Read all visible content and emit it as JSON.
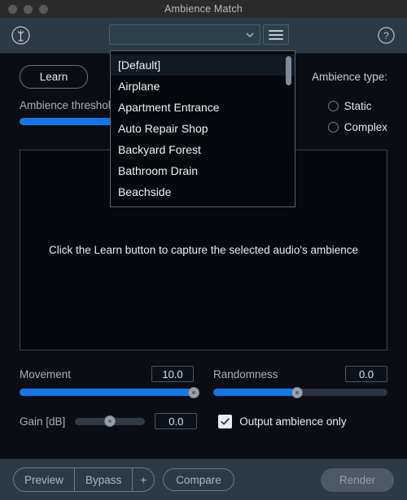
{
  "window": {
    "title": "Ambience Match",
    "traffic_lights": [
      "close",
      "minimize",
      "zoom"
    ]
  },
  "header": {
    "logo_icon": "tree-circle-icon",
    "preset_combobox": {
      "value": "",
      "placeholder": "",
      "chevron_icon": "chevron-down-icon"
    },
    "menu_button_icon": "hamburger-menu-icon",
    "help_icon": "help-circle-icon"
  },
  "dropdown": {
    "open": true,
    "items": [
      "[Default]",
      "Airplane",
      "Apartment Entrance",
      "Auto Repair Shop",
      "Backyard Forest",
      "Bathroom Drain",
      "Beachside"
    ],
    "selected_index": 0,
    "scrollbar_position": "top"
  },
  "controls": {
    "learn_button": "Learn",
    "type_label": "Ambience type:",
    "type_options": [
      {
        "label": "Static",
        "selected": false
      },
      {
        "label": "Complex",
        "selected": false
      }
    ],
    "threshold": {
      "label": "Ambience threshold",
      "fill_percent": 100
    }
  },
  "display": {
    "message": "Click the Learn button to capture the selected audio's ambience"
  },
  "params": [
    {
      "name": "Movement",
      "value": "10.0",
      "fill_percent": 100,
      "knob_percent": 100
    },
    {
      "name": "Randomness",
      "value": "0.0",
      "fill_percent": 48,
      "knob_percent": 48
    }
  ],
  "gain": {
    "label": "Gain [dB]",
    "value": "0.0",
    "knob_percent": 50
  },
  "output_ambience": {
    "label": "Output ambience only",
    "checked": true,
    "check_icon": "checkmark-icon"
  },
  "footer": {
    "preview": "Preview",
    "bypass": "Bypass",
    "add": "+",
    "compare": "Compare",
    "render": "Render"
  },
  "colors": {
    "accent_blue": "#1277e8",
    "header_bg": "#2a3b47",
    "body_bg": "#0a0d14",
    "titlebar_bg": "#2b2b2b"
  }
}
